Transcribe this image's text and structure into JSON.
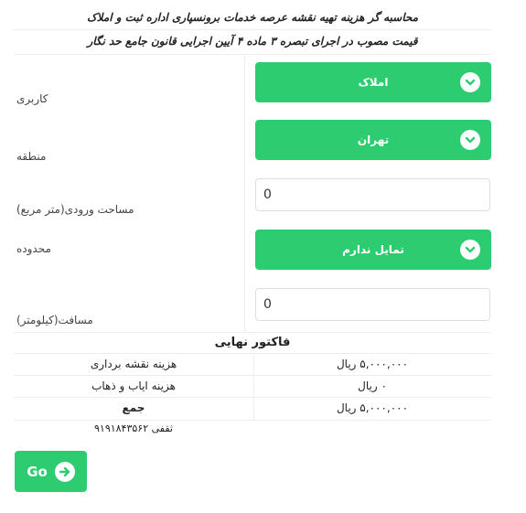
{
  "header": {
    "line1": "محاسبه گر هزینه تهیه نقشه عرصه خدمات برونسپاری اداره ثبت و املاک",
    "line2": "قیمت مصوب در اجرای تبصره ۳ ماده ۴ آیین اجرایی قانون جامع حد نگار"
  },
  "form": {
    "usage": {
      "label": "کاربری",
      "value": "املاک"
    },
    "region": {
      "label": "منطقه",
      "value": "تهران"
    },
    "area": {
      "label": "مساحت ورودی(متر مربع)",
      "value": "0"
    },
    "boundary": {
      "label": "محدوده",
      "value": "تمایل ندارم"
    },
    "distance": {
      "label": "مسافت(کیلومتر)",
      "value": "0"
    }
  },
  "invoice": {
    "title": "فاکتور نهایی",
    "rows": [
      {
        "label": "هزینه نقشه برداری",
        "amount": "۵,۰۰۰,۰۰۰ ریال"
      },
      {
        "label": "هزینه ایاب و ذهاب",
        "amount": "۰ ریال"
      },
      {
        "label": "جمع",
        "amount": "۵,۰۰۰,۰۰۰ ریال"
      }
    ],
    "contact": "ثقفی ۹۱۹۱۸۴۳۵۶۲"
  },
  "go_button": {
    "label": "Go",
    "icon": "arrow-right-icon"
  },
  "colors": {
    "accent": "#2ecc71",
    "border": "#eeeeee"
  }
}
